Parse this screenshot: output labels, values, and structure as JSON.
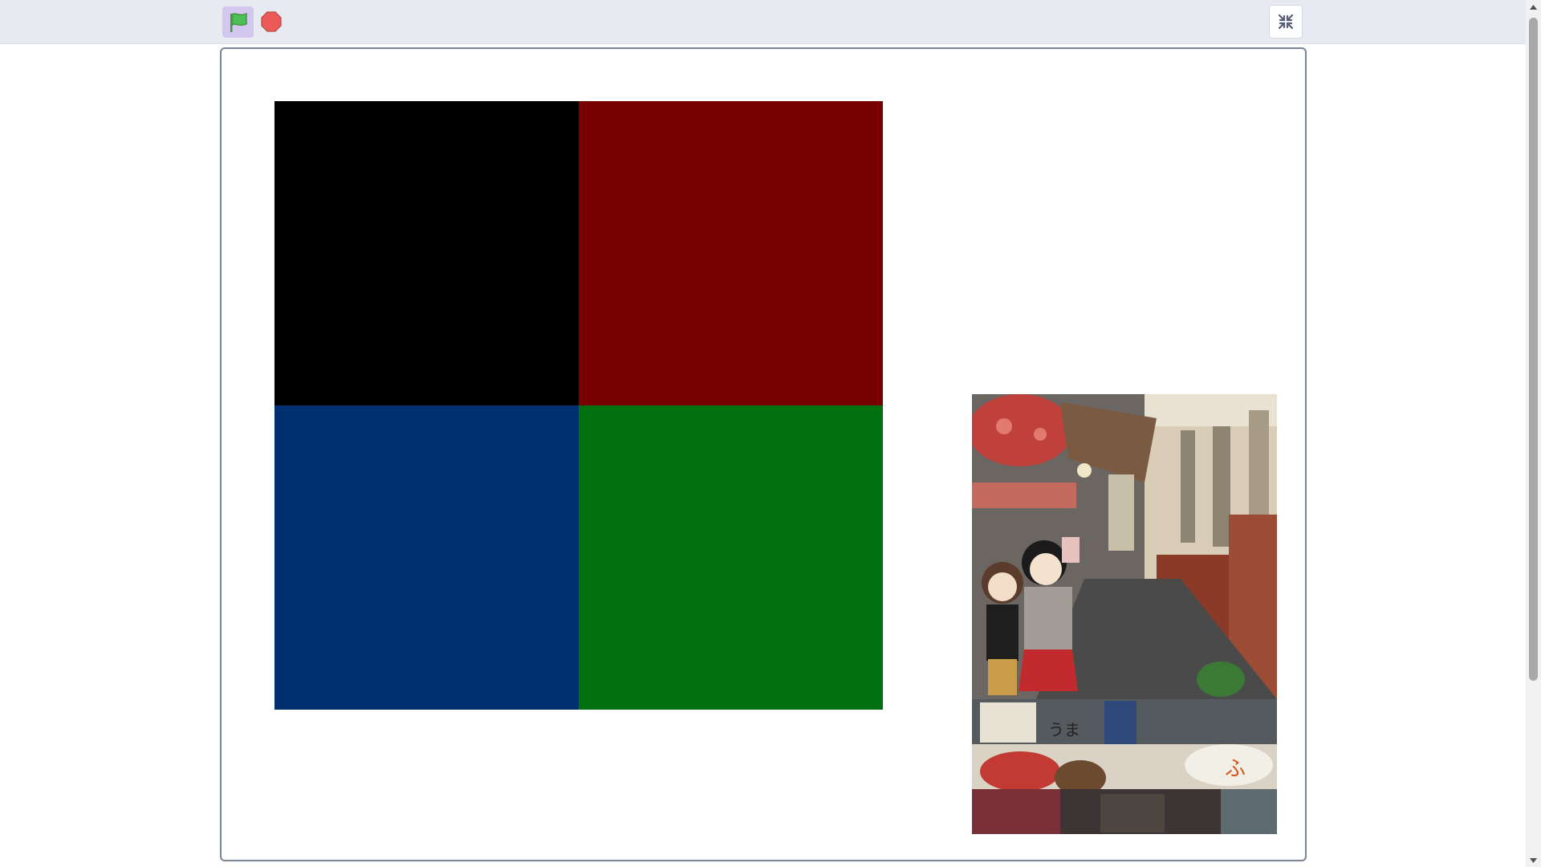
{
  "toolbar": {
    "green_flag_icon": "green-flag-icon",
    "stop_icon": "stop-icon",
    "fullscreen_icon": "unfullscreen-icon"
  },
  "stage": {
    "quadrant_colors": {
      "top_left": "#000000",
      "top_right": "#780000",
      "bottom_left": "#003070",
      "bottom_right": "#007010"
    },
    "sprite": {
      "name": "anime-street-scene",
      "sign_text": "うま",
      "sign_text_2": "ふ"
    }
  },
  "colors": {
    "topbar_bg": "#e7ebf1",
    "flag_button_bg": "#d3c7f0",
    "stage_border": "#7a8597"
  }
}
